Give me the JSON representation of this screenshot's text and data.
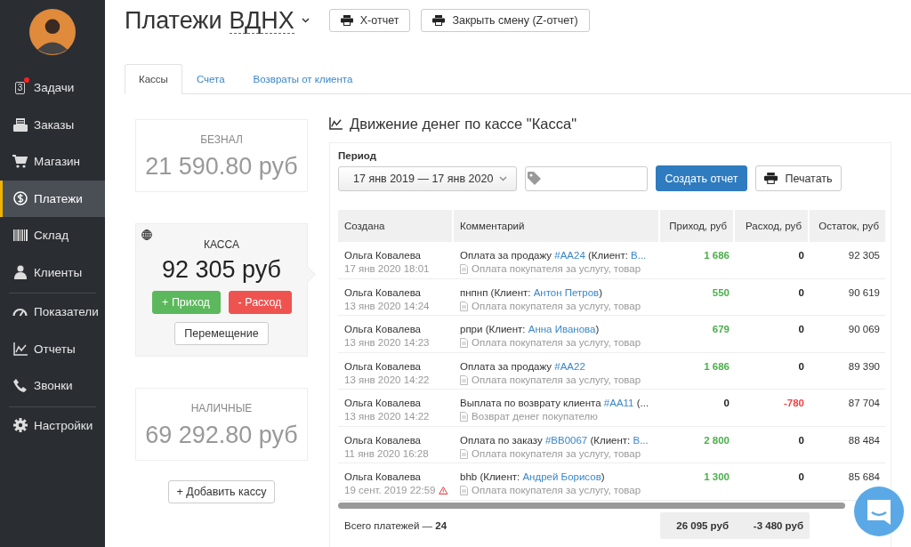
{
  "sidebar": {
    "groups": [
      {
        "items": [
          {
            "kind": "tasks",
            "label": "Задачи",
            "badge": "3",
            "notification": true,
            "selected": false
          },
          {
            "kind": "orders",
            "label": "Заказы",
            "selected": false
          },
          {
            "kind": "cart",
            "label": "Магазин",
            "selected": false
          },
          {
            "kind": "dollar",
            "label": "Платежи",
            "selected": true
          },
          {
            "kind": "barcode",
            "label": "Склад",
            "selected": false
          },
          {
            "kind": "person",
            "label": "Клиенты",
            "selected": false
          }
        ]
      },
      {
        "items": [
          {
            "kind": "gauge",
            "label": "Показатели",
            "selected": false
          },
          {
            "kind": "chart",
            "label": "Отчеты",
            "selected": false
          },
          {
            "kind": "phone",
            "label": "Звонки",
            "selected": false
          }
        ]
      },
      {
        "items": [
          {
            "kind": "gear",
            "label": "Настройки",
            "selected": false
          }
        ]
      }
    ]
  },
  "header": {
    "title": "Платежи",
    "location": "ВДНХ",
    "buttons": [
      "X-отчет",
      "Закрыть смену (Z-отчет)"
    ]
  },
  "tabs": [
    {
      "label": "Кассы",
      "selected": true
    },
    {
      "label": "Счета",
      "selected": false
    },
    {
      "label": "Возвраты от клиента",
      "selected": false
    }
  ],
  "cash_cards": [
    {
      "kind": "summary",
      "label": "БЕЗНАЛ",
      "amount": "21 590.80 руб",
      "selected": false
    },
    {
      "kind": "register",
      "label": "КАССА",
      "amount": "92 305 руб",
      "selected": true,
      "buttons": [
        "+ Приход",
        "- Расход",
        "Перемещение"
      ]
    },
    {
      "kind": "summary",
      "label": "НАЛИЧНЫЕ",
      "amount": "69 292.80 руб",
      "selected": false
    }
  ],
  "add_register_button": "+ Добавить кассу",
  "report": {
    "title": "Движение денег по кассе \"Касса\"",
    "period_label": "Период",
    "period": "17 янв 2019 — 17 янв 2020",
    "create_button": "Создать отчет",
    "print_button": "Печатать",
    "table": {
      "columns": [
        "Создана",
        "Комментарий",
        "Приход, руб",
        "Расход, руб",
        "Остаток, руб"
      ],
      "rows": [
        {
          "author": "Ольга Ковалева",
          "date": "17 янв 2020 18:01",
          "warning": false,
          "comment": [
            {
              "text": "Оплата за продажу "
            },
            {
              "text": "#AA24",
              "link": true
            },
            {
              "text": " (Клиент: "
            },
            {
              "text": "В...",
              "link": true
            }
          ],
          "note": "Оплата покупателя за услугу, товар",
          "kind": "income",
          "income": "1 686",
          "expense": "0",
          "balance": "92 305"
        },
        {
          "author": "Ольга Ковалева",
          "date": "13 янв 2020 14:24",
          "warning": false,
          "comment": [
            {
              "text": "пнпнп (Клиент: "
            },
            {
              "text": "Антон Петров",
              "link": true
            },
            {
              "text": ")"
            }
          ],
          "note": "Оплата покупателя за услугу, товар",
          "kind": "income",
          "income": "550",
          "expense": "0",
          "balance": "90 619"
        },
        {
          "author": "Ольга Ковалева",
          "date": "13 янв 2020 14:23",
          "warning": false,
          "comment": [
            {
              "text": "рпри (Клиент: "
            },
            {
              "text": "Анна Иванова",
              "link": true
            },
            {
              "text": ")"
            }
          ],
          "note": "Оплата покупателя за услугу, товар",
          "kind": "income",
          "income": "679",
          "expense": "0",
          "balance": "90 069"
        },
        {
          "author": "Ольга Ковалева",
          "date": "13 янв 2020 14:22",
          "warning": false,
          "comment": [
            {
              "text": "Оплата за продажу "
            },
            {
              "text": "#AA22",
              "link": true
            }
          ],
          "note": "Оплата покупателя за услугу, товар",
          "kind": "income",
          "income": "1 686",
          "expense": "0",
          "balance": "89 390"
        },
        {
          "author": "Ольга Ковалева",
          "date": "13 янв 2020 14:22",
          "warning": false,
          "comment": [
            {
              "text": "Выплата по возврату клиента "
            },
            {
              "text": "#AA11",
              "link": true
            },
            {
              "text": " (..."
            }
          ],
          "note": "Возврат денег покупателю",
          "kind": "refund",
          "income": "0",
          "expense": "-780",
          "balance": "87 704"
        },
        {
          "author": "Ольга Ковалева",
          "date": "11 янв 2020 16:28",
          "warning": false,
          "comment": [
            {
              "text": "Оплата по заказу "
            },
            {
              "text": "#BB0067",
              "link": true
            },
            {
              "text": " (Клиент: "
            },
            {
              "text": "В...",
              "link": true
            }
          ],
          "note": "Оплата покупателя за услугу, товар",
          "kind": "income",
          "income": "2 800",
          "expense": "0",
          "balance": "88 484"
        },
        {
          "author": "Ольга Ковалева",
          "date": "19 сент. 2019 22:59",
          "warning": true,
          "comment": [
            {
              "text": "bhb (Клиент: "
            },
            {
              "text": "Андрей Борисов",
              "link": true
            },
            {
              "text": ")"
            }
          ],
          "note": "Оплата покупателя за услугу, товар",
          "kind": "income",
          "income": "1 300",
          "expense": "0",
          "balance": "85 684"
        }
      ],
      "footer": {
        "count": "Всего платежей — **24**",
        "income_total": "26 095 руб",
        "expense_total": "-3 480 руб"
      }
    }
  }
}
